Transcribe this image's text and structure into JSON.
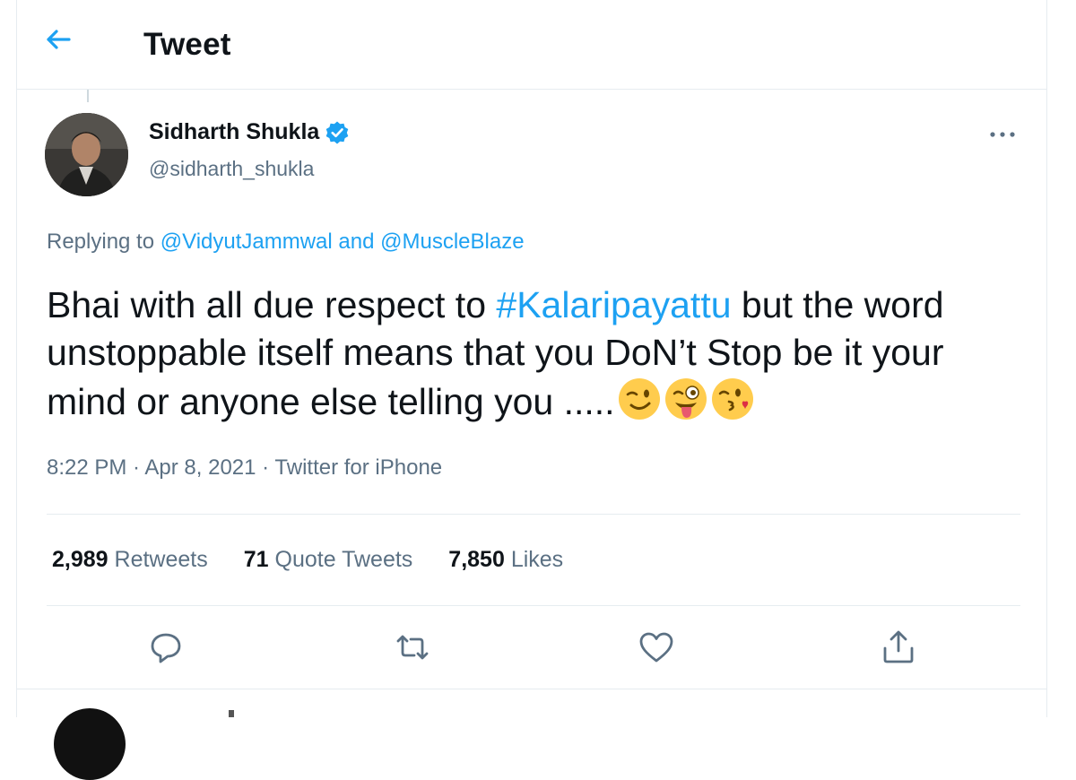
{
  "header": {
    "title": "Tweet"
  },
  "tweet": {
    "author_name": "Sidharth Shukla",
    "author_handle": "@sidharth_shukla",
    "replying_prefix": "Replying to ",
    "reply_to_1": "@VidyutJammwal",
    "reply_and": " and ",
    "reply_to_2": "@MuscleBlaze",
    "text_part1": "Bhai with all due respect to ",
    "hashtag": "#Kalaripayattu",
    "text_part2": " but the word unstoppable itself means that you DoN’t Stop be it your mind or anyone else telling you .....",
    "emojis": [
      "wink-emoji",
      "tongue-wink-emoji",
      "kiss-emoji"
    ],
    "time": "8:22 PM",
    "date": "Apr 8, 2021",
    "source": "Twitter for iPhone",
    "separator": " · "
  },
  "stats": {
    "retweets_count": "2,989",
    "retweets_label": "Retweets",
    "quotes_count": "71",
    "quotes_label": "Quote Tweets",
    "likes_count": "7,850",
    "likes_label": "Likes"
  },
  "colors": {
    "accent": "#1da1f2",
    "secondary_text": "#5b7083",
    "divider": "#e6ecf0"
  },
  "icons": [
    "back-arrow-icon",
    "verified-badge-icon",
    "more-icon",
    "reply-icon",
    "retweet-icon",
    "like-icon",
    "share-icon"
  ]
}
